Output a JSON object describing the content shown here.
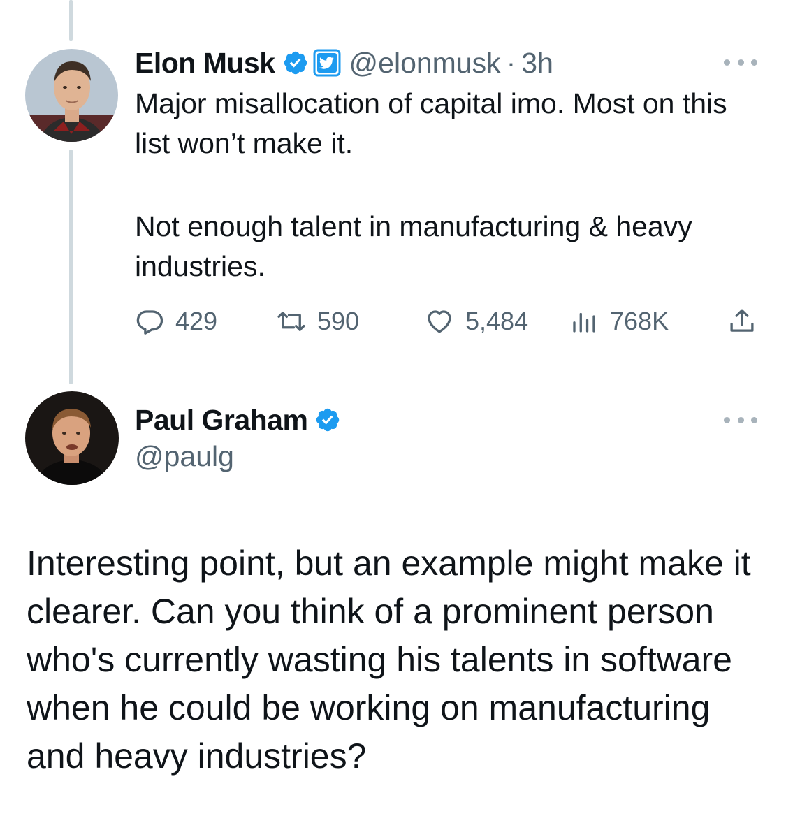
{
  "tweet_original": {
    "display_name": "Elon Musk",
    "handle": "@elonmusk",
    "separator": "·",
    "time": "3h",
    "text_paragraph_1": "Major misallocation of capital imo. Most on this list won’t make it.",
    "text_paragraph_2": "Not enough talent in manufacturing & heavy industries.",
    "actions": {
      "reply_count": "429",
      "retweet_count": "590",
      "like_count": "5,484",
      "view_count": "768K"
    }
  },
  "tweet_reply": {
    "display_name": "Paul Graham",
    "handle": "@paulg",
    "text": "Interesting point, but an example might make it clearer. Can you think of a prominent person who's currently wasting his talents in software when he could be working on manufacturing and heavy industries?"
  },
  "colors": {
    "text_primary": "#0f1419",
    "text_secondary": "#536471",
    "verified_blue": "#1d9bf0",
    "thread_line": "#cfd9de"
  },
  "icons": {
    "reply": "reply-icon",
    "retweet": "retweet-icon",
    "like": "heart-icon",
    "views": "views-icon",
    "share": "share-icon",
    "verified": "verified-badge-icon",
    "affiliate": "twitter-bird-badge-icon",
    "more": "more-options-icon"
  }
}
